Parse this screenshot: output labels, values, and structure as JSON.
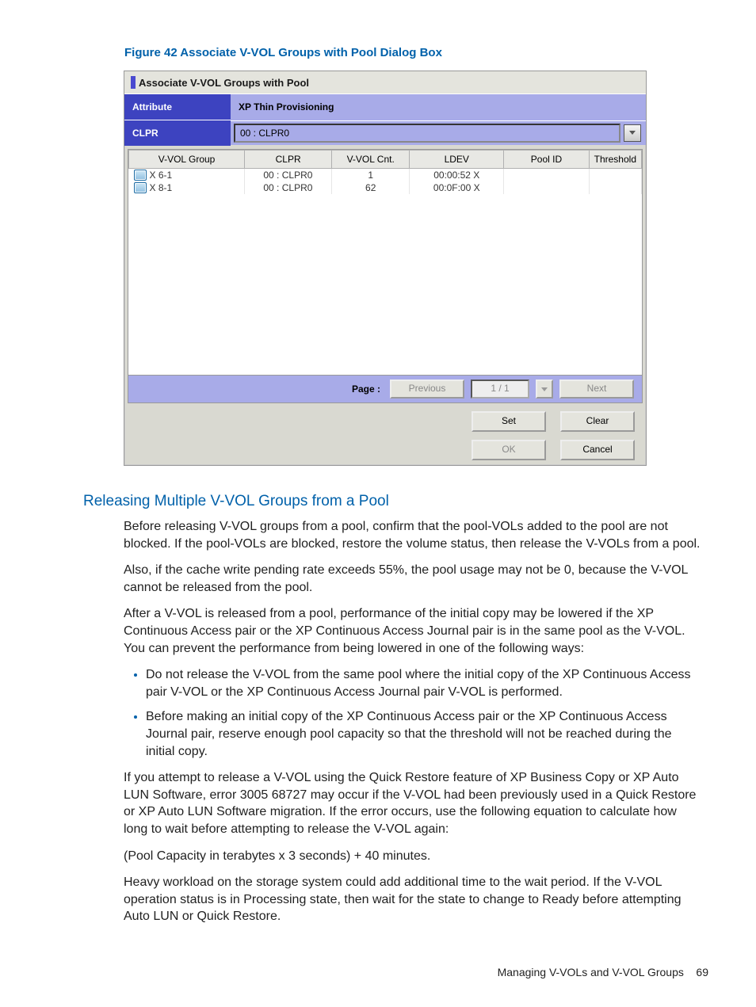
{
  "figure_caption": "Figure 42 Associate V-VOL Groups with Pool Dialog Box",
  "dialog": {
    "title": "Associate V-VOL Groups with Pool",
    "attribute_label": "Attribute",
    "attribute_value": "XP Thin Provisioning",
    "clpr_label": "CLPR",
    "clpr_value": "00 : CLPR0",
    "columns": [
      "V-VOL Group",
      "CLPR",
      "V-VOL Cnt.",
      "LDEV",
      "Pool ID",
      "Threshold"
    ],
    "rows": [
      {
        "group": "X 6-1",
        "clpr": "00 : CLPR0",
        "cnt": "1",
        "ldev": "00:00:52 X",
        "pool": "",
        "threshold": ""
      },
      {
        "group": "X 8-1",
        "clpr": "00 : CLPR0",
        "cnt": "62",
        "ldev": "00:0F:00 X",
        "pool": "",
        "threshold": ""
      }
    ],
    "pager": {
      "label": "Page :",
      "prev": "Previous",
      "value": "1 / 1",
      "next": "Next"
    },
    "buttons": {
      "set": "Set",
      "clear": "Clear",
      "ok": "OK",
      "cancel": "Cancel"
    }
  },
  "section_heading": "Releasing Multiple V-VOL Groups from a Pool",
  "para1": "Before releasing V-VOL groups from a pool, confirm that the pool-VOLs added to the pool are not blocked. If the pool-VOLs are blocked, restore the volume status, then release the V-VOLs from a pool.",
  "para2": "Also, if the cache write pending rate exceeds 55%, the pool usage may not be 0, because the V-VOL cannot be released from the pool.",
  "para3": "After a V-VOL is released from a pool, performance of the initial copy may be lowered if the XP Continuous Access pair or the XP Continuous Access Journal pair is in the same pool as the V-VOL. You can prevent the performance from being lowered in one of the following ways:",
  "bullet1": "Do not release the V-VOL from the same pool where the initial copy of the XP Continuous Access pair V-VOL or the XP Continuous Access Journal pair V-VOL is performed.",
  "bullet2": "Before making an initial copy of the XP Continuous Access pair or the XP Continuous Access Journal pair, reserve enough pool capacity so that the threshold will not be reached during the initial copy.",
  "para4": "If you attempt to release a V-VOL using the Quick Restore feature of XP Business Copy or XP Auto LUN Software, error 3005 68727 may occur if the V-VOL had been previously used in a Quick Restore or XP Auto LUN Software migration. If the error occurs, use the following equation to calculate how long to wait before attempting to release the V-VOL again:",
  "para5": "(Pool Capacity in terabytes x 3 seconds) + 40 minutes.",
  "para6": "Heavy workload on the storage system could add additional time to the wait period. If the V-VOL operation status is in Processing state, then wait for the state to change to Ready before attempting Auto LUN or Quick Restore.",
  "footer_section": "Managing V-VOLs and V-VOL Groups",
  "footer_page": "69"
}
